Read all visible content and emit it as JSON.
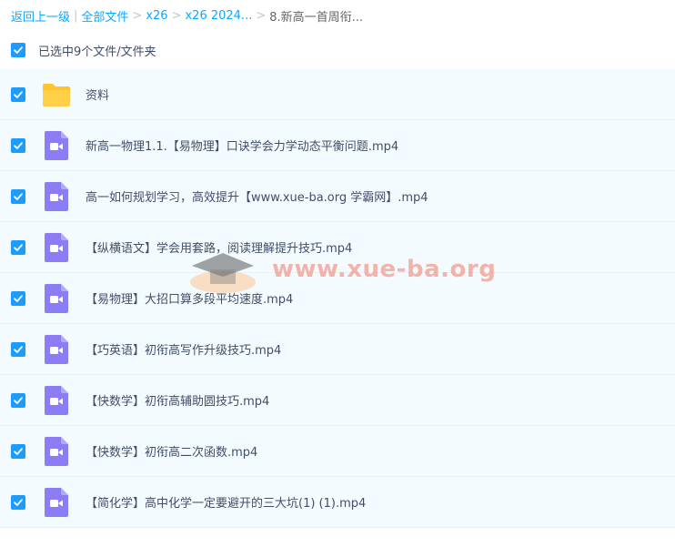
{
  "breadcrumb": {
    "back": "返回上一级",
    "all_files": "全部文件",
    "items": [
      "x26",
      "x26 2024...",
      "8.新高一首周衔..."
    ]
  },
  "selection": {
    "label": "已选中9个文件/文件夹"
  },
  "files": [
    {
      "name": "资料",
      "type": "folder-icon"
    },
    {
      "name": "新高一物理1.1.【易物理】口诀学会力学动态平衡问题.mp4",
      "type": "video-icon"
    },
    {
      "name": "高一如何规划学习，高效提升【www.xue-ba.org 学霸网】.mp4",
      "type": "video-icon"
    },
    {
      "name": "【纵横语文】学会用套路，阅读理解提升技巧.mp4",
      "type": "video-icon"
    },
    {
      "name": "【易物理】大招口算多段平均速度.mp4",
      "type": "video-icon"
    },
    {
      "name": "【巧英语】初衔高写作升级技巧.mp4",
      "type": "video-icon"
    },
    {
      "name": "【快数学】初衔高辅助圆技巧.mp4",
      "type": "video-icon"
    },
    {
      "name": "【快数学】初衔高二次函数.mp4",
      "type": "video-icon"
    },
    {
      "name": "【简化学】高中化学一定要避开的三大坑(1) (1).mp4",
      "type": "video-icon"
    }
  ],
  "watermark": {
    "text": "www.xue-ba.org"
  },
  "colors": {
    "link": "#09aaff",
    "checkbox": "#1e9bff",
    "row_bg": "#f4fbff",
    "folder": "#ffd04a",
    "video": "#8c7df5"
  }
}
